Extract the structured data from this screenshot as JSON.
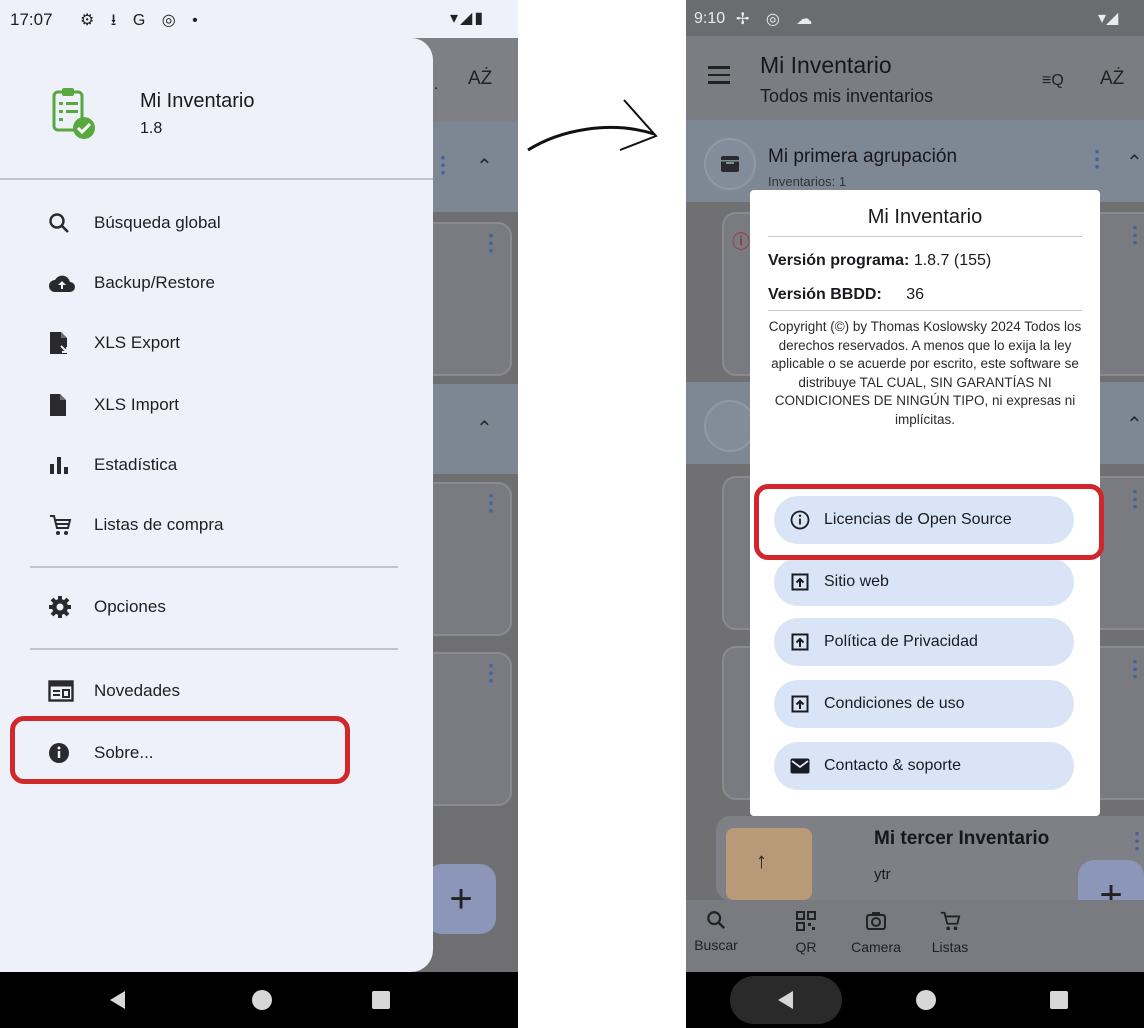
{
  "left": {
    "status": {
      "time": "17:07",
      "icons": "⚙ ⭳ G ◎ •",
      "right_icons": "▾◢▮"
    },
    "drawer": {
      "app_name": "Mi Inventario",
      "app_version": "1.8",
      "items": [
        {
          "label": "Búsqueda global",
          "icon": "search-icon"
        },
        {
          "label": "Backup/Restore",
          "icon": "cloud-upload-icon"
        },
        {
          "label": "XLS Export",
          "icon": "file-export-icon"
        },
        {
          "label": "XLS Import",
          "icon": "file-icon"
        },
        {
          "label": "Estadística",
          "icon": "bar-chart-icon"
        },
        {
          "label": "Listas de compra",
          "icon": "shopping-cart-icon"
        },
        {
          "label": "Opciones",
          "icon": "gear-icon"
        },
        {
          "label": "Novedades",
          "icon": "news-icon"
        },
        {
          "label": "Sobre...",
          "icon": "info-icon"
        }
      ]
    },
    "appbar_right": "AŻ"
  },
  "right": {
    "status": {
      "time": "9:10"
    },
    "appbar": {
      "title": "Mi Inventario",
      "subtitle": "Todos mis inventarios",
      "sort_label": "AŻ"
    },
    "group": {
      "title": "Mi primera agrupación",
      "subtitle": "Inventarios: 1"
    },
    "third_inventory": {
      "title": "Mi tercer Inventario",
      "subtitle": "ytr"
    },
    "dialog": {
      "title": "Mi Inventario",
      "program_version_label": "Versión programa:",
      "program_version_value": "1.8.7 (155)",
      "db_version_label": "Versión BBDD:",
      "db_version_value": "36",
      "copyright": "Copyright (©) by Thomas Koslowsky 2024 Todos los derechos reservados. A menos que lo exija la ley aplicable o se acuerde por escrito, este software se distribuye TAL CUAL, SIN GARANTÍAS NI CONDICIONES DE NINGÚN TIPO, ni expresas ni implícitas.",
      "buttons": [
        {
          "label": "Licencias de Open Source",
          "icon": "info-outline-icon"
        },
        {
          "label": "Sitio web",
          "icon": "open-external-icon"
        },
        {
          "label": "Política de Privacidad",
          "icon": "open-external-icon"
        },
        {
          "label": "Condiciones de uso",
          "icon": "open-external-icon"
        },
        {
          "label": "Contacto & soporte",
          "icon": "mail-icon"
        }
      ]
    },
    "bottom_nav": [
      {
        "label": "Buscar",
        "icon": "search-icon"
      },
      {
        "label": "QR",
        "icon": "qr-code-icon"
      },
      {
        "label": "Camera",
        "icon": "camera-icon"
      },
      {
        "label": "Listas",
        "icon": "shopping-cart-icon"
      }
    ]
  },
  "colors": {
    "highlight": "#d0272a",
    "pill": "#d9e4f7",
    "drawer": "#eef1f9",
    "accent": "#3f5fa0"
  }
}
